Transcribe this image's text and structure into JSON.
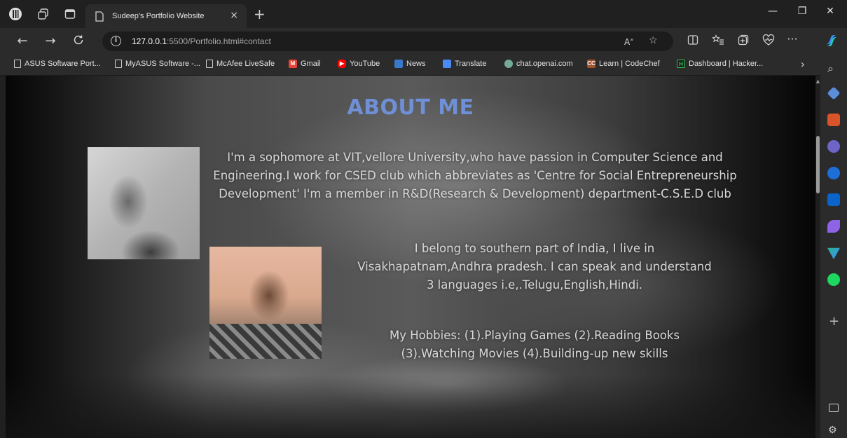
{
  "tab": {
    "title": "Sudeep's Portfolio Website",
    "close": "×",
    "new_tab": "+"
  },
  "window": {
    "minimize": "—",
    "restore": "❐",
    "close": "✕"
  },
  "address_bar": {
    "url_host": "127.0.0.1",
    "url_path": ":5500/Portfolio.html#contact",
    "info": "i"
  },
  "favorites": [
    {
      "label": "ASUS Software Port...",
      "icon": "page-icon"
    },
    {
      "label": "MyASUS Software -...",
      "icon": "page-icon"
    },
    {
      "label": "McAfee LiveSafe",
      "icon": "page-icon"
    },
    {
      "label": "Gmail",
      "icon": "gmail-icon",
      "color": "#ea4335"
    },
    {
      "label": "YouTube",
      "icon": "youtube-icon",
      "color": "#ff0000"
    },
    {
      "label": "News",
      "icon": "news-icon",
      "color": "#3a78c9"
    },
    {
      "label": "Translate",
      "icon": "translate-icon",
      "color": "#4a8af4"
    },
    {
      "label": "chat.openai.com",
      "icon": "openai-icon",
      "color": "#74aa9c"
    },
    {
      "label": "Learn | CodeChef",
      "icon": "codechef-icon",
      "color": "#a0522d",
      "badge": "CC"
    },
    {
      "label": "Dashboard | Hacker...",
      "icon": "hackerrank-icon",
      "color": "#1a1a1a",
      "badge": "H"
    }
  ],
  "content": {
    "title": "ABOUT ME",
    "paragraph1": "I'm a sophomore at VIT,vellore University,who have passion in Computer Science and Engineering.I work for CSED club which abbreviates as 'Centre for Social Entrepreneurship Development' I'm a member in R&D(Research & Development) department-C.S.E.D club",
    "paragraph2": "I belong to southern part of India, I live in Visakhapatnam,Andhra pradesh. I can speak and understand 3 languages i.e,.Telugu,English,Hindi.",
    "paragraph3": "My Hobbies: (1).Playing Games (2).Reading Books (3).Watching Movies (4).Building-up new skills"
  },
  "colors": {
    "title_blue": "#6f8fd6",
    "chrome_dark": "#202020",
    "chrome_mid": "#2b2b2b"
  }
}
